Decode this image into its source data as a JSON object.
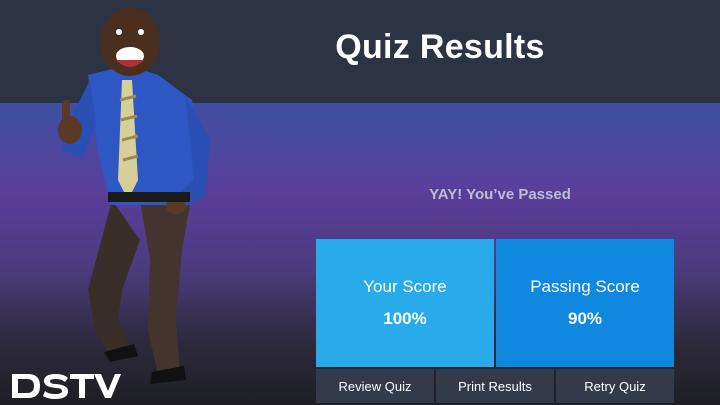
{
  "header": {
    "title": "Quiz Results"
  },
  "result": {
    "status_message": "YAY! You’ve Passed",
    "your_score_label": "Your Score",
    "your_score_value": "100%",
    "passing_score_label": "Passing Score",
    "passing_score_value": "90%"
  },
  "buttons": {
    "review_label": "Review Quiz",
    "print_label": "Print Results",
    "retry_label": "Retry Quiz"
  },
  "brand": {
    "logo_text": "DStv"
  },
  "colors": {
    "header_bg": "#2c3444",
    "your_score_bg": "#29abeb",
    "passing_score_bg": "#1088e0",
    "button_bg": "#333a4a"
  }
}
